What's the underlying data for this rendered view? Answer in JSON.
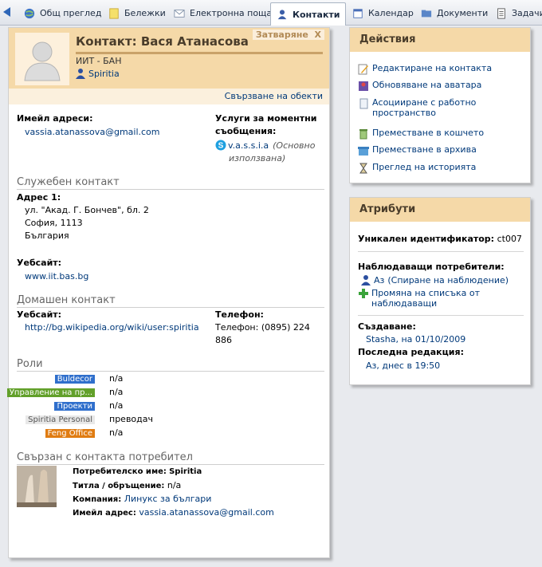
{
  "tabs": [
    {
      "label": "Общ преглед",
      "icon": "globe-icon"
    },
    {
      "label": "Бележки",
      "icon": "note-icon"
    },
    {
      "label": "Електронна поща",
      "icon": "envelope-icon"
    },
    {
      "label": "Контакти",
      "icon": "contact-icon"
    },
    {
      "label": "Календар",
      "icon": "calendar-icon"
    },
    {
      "label": "Документи",
      "icon": "documents-icon"
    },
    {
      "label": "Задачи",
      "icon": "tasks-icon"
    }
  ],
  "contact": {
    "title": "Контакт: Вася Атанасова",
    "close_label": "Затваряне",
    "close_x": "X",
    "organization": "ИИТ - БАН",
    "user": "Spiritia",
    "link_objects": "Свързване на обекти",
    "email_label": "Имейл адреси:",
    "email": "vassia.atanassova@gmail.com",
    "im_label_1": "Услуги за моментни",
    "im_label_2": "съобщения:",
    "im_handle": "v.a.s.s.i.a",
    "im_note_1": "(Основно",
    "im_note_2": "използвана)",
    "work_title": "Служебен контакт",
    "address_label": "Адрес 1:",
    "address_line1": "ул. \"Акад. Г. Бончев\", бл. 2",
    "address_line2": "София, 1113",
    "address_line3": "България",
    "website_label": "Уебсайт:",
    "website": "www.iit.bas.bg",
    "home_title": "Домашен контакт",
    "home_website_label": "Уебсайт:",
    "home_website": "http://bg.wikipedia.org/wiki/user:spiritia",
    "phone_label": "Телефон:",
    "phone_line1": "Телефон: (0895) 224",
    "phone_line2": "886",
    "roles_title": "Роли",
    "roles": [
      {
        "tag": "Buldecor",
        "value": "n/a",
        "color": "#2f6fcc"
      },
      {
        "tag": "Управление на пр...",
        "value": "n/a",
        "color": "#62a02a"
      },
      {
        "tag": "Проекти",
        "value": "n/a",
        "color": "#2f6fcc"
      },
      {
        "tag": "Spiritia Personal",
        "value": "преводач",
        "color": "#e8e8e8"
      },
      {
        "tag": "Feng Office",
        "value": "n/a",
        "color": "#e07c12"
      }
    ],
    "linked_user_title": "Свързан с контакта потребител",
    "username_label": "Потребителско име:",
    "username": "Spiritia",
    "salutation_label": "Титла / обръщение:",
    "salutation": "n/a",
    "company_label": "Компания:",
    "company": "Линукс за българи",
    "linked_email_label": "Имейл адрес:",
    "linked_email": "vassia.atanassova@gmail.com"
  },
  "actions": {
    "title": "Действия",
    "items": [
      {
        "label": "Редактиране на контакта",
        "icon": "edit-icon"
      },
      {
        "label": "Обновяване на аватара",
        "icon": "avatar-icon"
      },
      {
        "label": "Асоцииране с работно",
        "label2": "пространство",
        "icon": "workspace-icon"
      },
      {
        "label": "Преместване в кошчето",
        "icon": "trash-icon"
      },
      {
        "label": "Преместване в архива",
        "icon": "archive-icon"
      },
      {
        "label": "Преглед на историята",
        "icon": "hourglass-icon"
      }
    ]
  },
  "attributes": {
    "title": "Атрибути",
    "uid_label": "Уникален идентификатор:",
    "uid": "ct007",
    "watchers_label": "Наблюдаващи потребители:",
    "watcher_me": "Аз",
    "stop_watching": "(Спиране на наблюдение)",
    "change_list_1": "Промяна на списъка от",
    "change_list_2": "наблюдаващи",
    "created_label": "Създаване:",
    "created_value": "Stasha, на 01/10/2009",
    "modified_label": "Последна редакция:",
    "modified_value": "Аз, днес в 19:50"
  }
}
